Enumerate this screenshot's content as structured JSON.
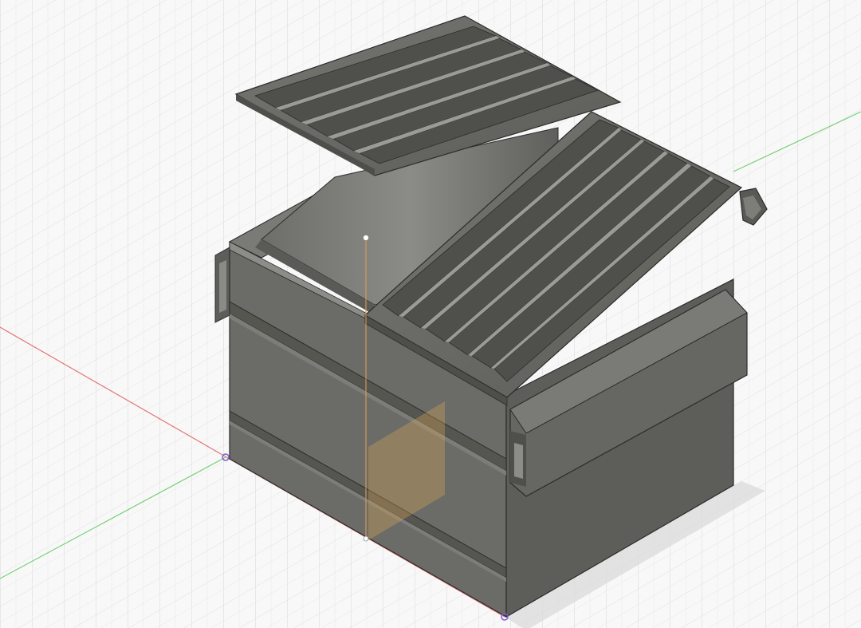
{
  "viewport": {
    "name": "3d-design-viewport",
    "background": "#f7f7f7",
    "grid_minor_color": "#e2e2e2",
    "grid_major_color": "#cfcfcf"
  },
  "axes": {
    "x_color": "#e06060",
    "z_color": "#66cc66",
    "y_color": "#e39a55"
  },
  "model": {
    "name": "dumpster",
    "body_color": "#6b6c67",
    "shade_color": "#565752",
    "highlight_color": "#8a8b86",
    "edge_color": "#2b2c2a"
  },
  "origin": {
    "plane_color": "#d9a45a"
  }
}
